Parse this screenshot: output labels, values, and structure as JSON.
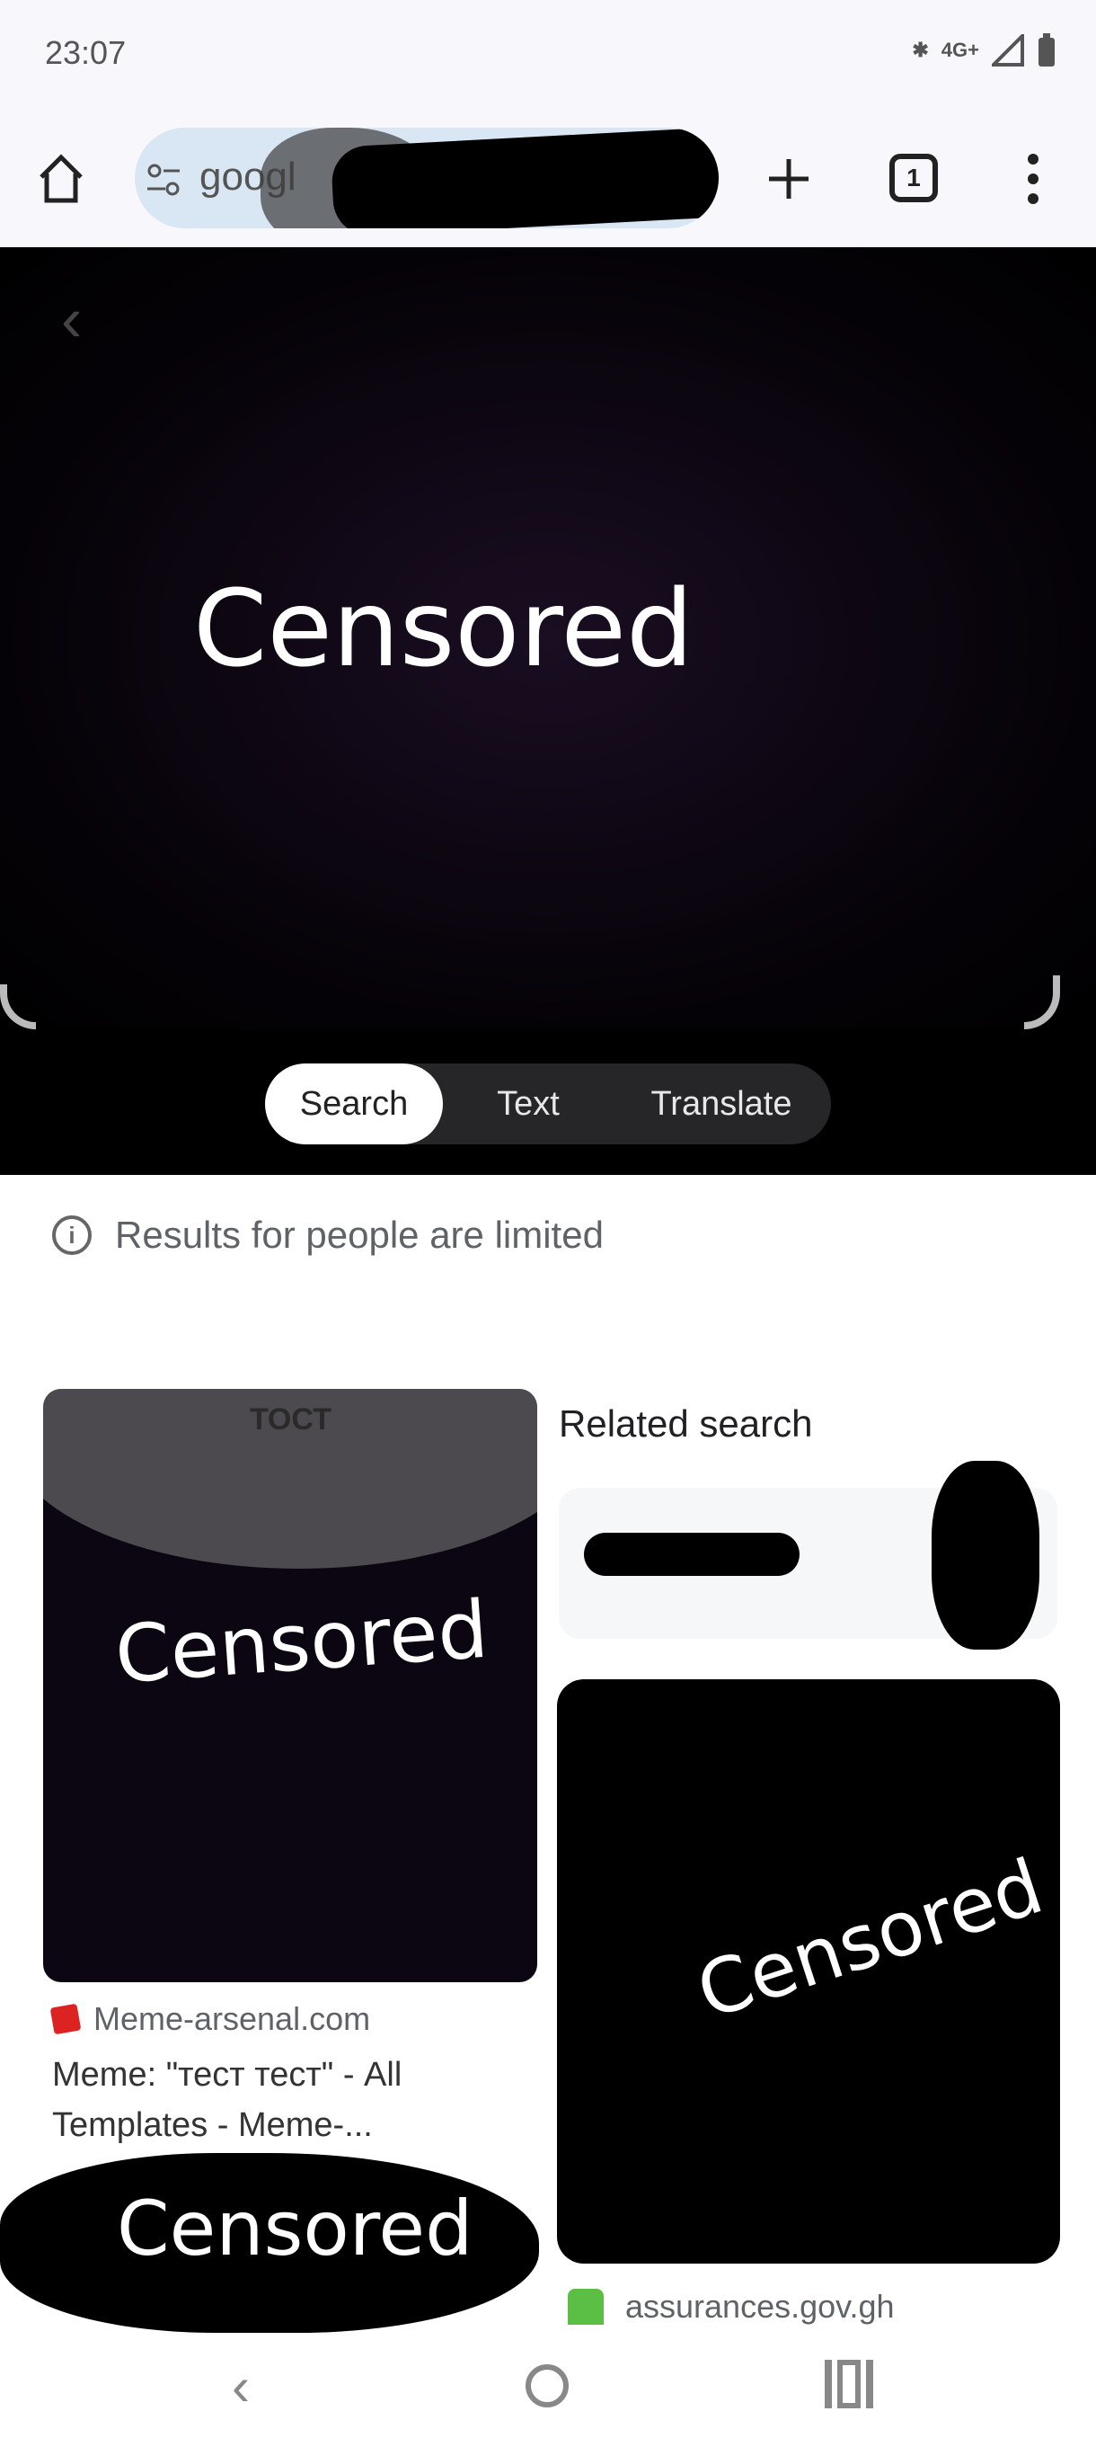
{
  "status_bar": {
    "time": "23:07",
    "network": "4G+",
    "icons": [
      "bluetooth-icon",
      "signal-icon",
      "battery-icon"
    ]
  },
  "browser_toolbar": {
    "url_text": "googl",
    "tab_count": "1",
    "icons": [
      "home-icon",
      "site-settings-icon",
      "new-tab-icon",
      "tab-switcher-icon",
      "more-menu-icon"
    ]
  },
  "image_viewer": {
    "censored_label": "Censored",
    "modes": [
      {
        "label": "Search",
        "active": true
      },
      {
        "label": "Text",
        "active": false
      },
      {
        "label": "Translate",
        "active": false
      }
    ]
  },
  "notice": {
    "text": "Results for people are limited"
  },
  "results": {
    "left_card": {
      "overlay_text": "ТОСТ",
      "censored_label": "Censored",
      "source": "Meme-arsenal.com",
      "title": "Meme: \"тест тест\" - All Templates - Meme-...",
      "bottom_censored_label": "Censored"
    },
    "related_search": {
      "heading": "Related search"
    },
    "right_card": {
      "censored_label": "Censored",
      "source": "assurances.gov.gh"
    }
  },
  "nav_bar": {
    "buttons": [
      "back",
      "home",
      "recents"
    ]
  }
}
